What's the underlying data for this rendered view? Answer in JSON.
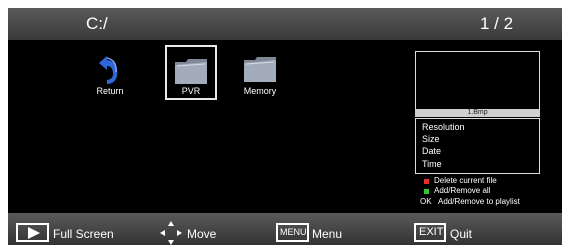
{
  "header": {
    "path": "C:/",
    "page": "1 / 2"
  },
  "items": [
    {
      "label": "Return",
      "icon": "return-arrow-icon"
    },
    {
      "label": "PVR",
      "icon": "folder-icon",
      "selected": true
    },
    {
      "label": "Memory",
      "icon": "folder-icon"
    }
  ],
  "preview": {
    "filename": "1.Bmp"
  },
  "info": {
    "resolution": "Resolution",
    "size": "Size",
    "date": "Date",
    "time": "Time"
  },
  "hints": {
    "delete": "Delete current file",
    "add_remove_all": "Add/Remove all",
    "ok_key": "OK",
    "ok_action": "Add/Remove to playlist"
  },
  "colors": {
    "red": "#e53030",
    "green": "#32c83a",
    "folder": "#9ea7b5",
    "return": "#2f66d8"
  },
  "bottom": {
    "fullscreen_label": "Full Screen",
    "move_label": "Move",
    "menu_key": "MENU",
    "menu_label": "Menu",
    "exit_key": "EXIT",
    "exit_label": "Quit"
  }
}
